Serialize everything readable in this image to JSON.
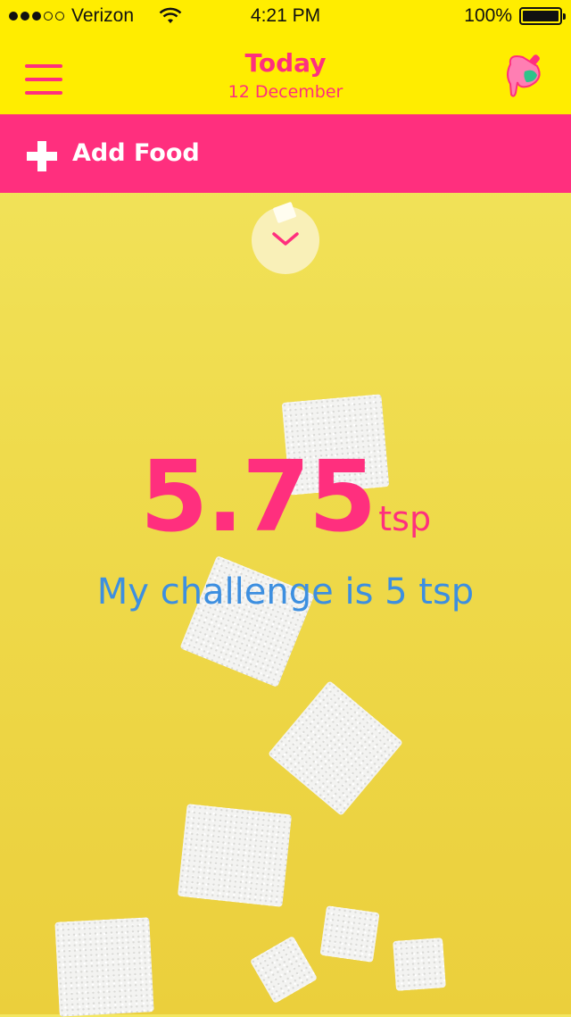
{
  "status_bar": {
    "carrier": "Verizon",
    "time": "4:21 PM",
    "battery": "100%",
    "signal_icon": "signal-dots-icon",
    "wifi_icon": "wifi-icon",
    "battery_icon": "battery-icon"
  },
  "nav": {
    "title": "Today",
    "date": "12 December",
    "menu_icon": "hamburger-menu-icon",
    "profile_icon": "popsicle-icon"
  },
  "add_food": {
    "label": "Add Food",
    "icon": "plus-icon"
  },
  "toggle_icon": "chevron-down-icon",
  "summary": {
    "amount": "5.75",
    "unit": "tsp",
    "challenge_text": "My challenge is 5 tsp"
  },
  "colors": {
    "header_yellow": "#ffed00",
    "accent_pink": "#ff2f7e",
    "challenge_blue": "#3d8fe0",
    "background_yellow": "#efdb4c"
  }
}
